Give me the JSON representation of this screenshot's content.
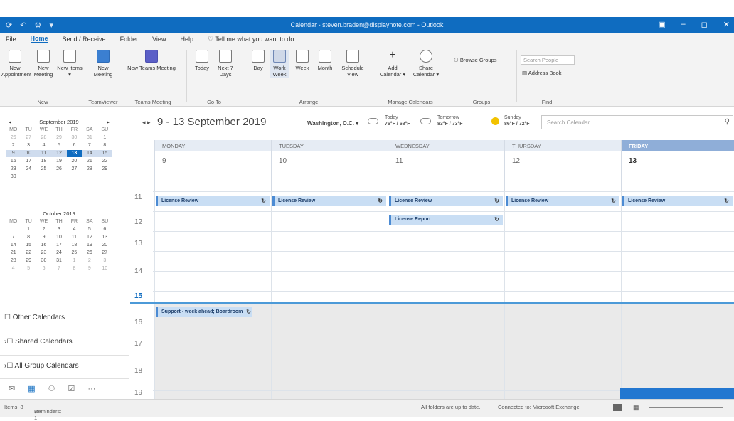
{
  "window": {
    "title": "Calendar - steven.braden@displaynote.com - Outlook",
    "qat": "⟳ ↶ ⚙ ▾"
  },
  "menu": [
    "File",
    "Home",
    "Send / Receive",
    "Folder",
    "View",
    "Help",
    "Tell me what you want to do"
  ],
  "ribbon": {
    "new_appointment": "New Appointment",
    "new_meeting": "New Meeting",
    "new_items": "New Items ▾",
    "new_meeting_tv": "New Meeting",
    "new_teams_meeting": "New Teams Meeting",
    "today": "Today",
    "next7": "Next 7 Days",
    "day": "Day",
    "work_week": "Work Week",
    "week": "Week",
    "month": "Month",
    "schedule_view": "Schedule View",
    "add_calendar": "Add Calendar ▾",
    "share_calendar": "Share Calendar ▾",
    "browse_groups": "Browse Groups",
    "search_people": "Search People",
    "address_book": "Address Book",
    "groups": {
      "new": "New",
      "teamviewer": "TeamViewer",
      "teams_meeting": "Teams Meeting",
      "go_to": "Go To",
      "arrange": "Arrange",
      "manage": "Manage Calendars",
      "groups": "Groups",
      "find": "Find"
    }
  },
  "mini_cal": [
    {
      "title": "September 2019",
      "days": [
        "MO",
        "TU",
        "WE",
        "TH",
        "FR",
        "SA",
        "SU"
      ],
      "rows": [
        [
          "26",
          "27",
          "28",
          "29",
          "30",
          "31",
          "1"
        ],
        [
          "2",
          "3",
          "4",
          "5",
          "6",
          "7",
          "8"
        ],
        [
          "9",
          "10",
          "11",
          "12",
          "13",
          "14",
          "15"
        ],
        [
          "16",
          "17",
          "18",
          "19",
          "20",
          "21",
          "22"
        ],
        [
          "23",
          "24",
          "25",
          "26",
          "27",
          "28",
          "29"
        ],
        [
          "30",
          "",
          "",
          "",
          "",
          "",
          ""
        ]
      ]
    },
    {
      "title": "October 2019",
      "days": [
        "MO",
        "TU",
        "WE",
        "TH",
        "FR",
        "SA",
        "SU"
      ],
      "rows": [
        [
          "",
          "1",
          "2",
          "3",
          "4",
          "5",
          "6"
        ],
        [
          "7",
          "8",
          "9",
          "10",
          "11",
          "12",
          "13"
        ],
        [
          "14",
          "15",
          "16",
          "17",
          "18",
          "19",
          "20"
        ],
        [
          "21",
          "22",
          "23",
          "24",
          "25",
          "26",
          "27"
        ],
        [
          "28",
          "29",
          "30",
          "31",
          "1",
          "2",
          "3"
        ],
        [
          "4",
          "5",
          "6",
          "7",
          "8",
          "9",
          "10"
        ]
      ]
    }
  ],
  "folders": [
    "Other Calendars",
    "Shared Calendars",
    "All Group Calendars"
  ],
  "calendar": {
    "range": "9 - 13 September 2019",
    "location": "Washington, D.C. ▾",
    "weather": [
      {
        "day": "Today",
        "temp": "76°F / 68°F"
      },
      {
        "day": "Tomorrow",
        "temp": "83°F / 73°F"
      },
      {
        "day": "Sunday",
        "temp": "86°F / 72°F"
      }
    ],
    "search_placeholder": "Search Calendar",
    "days": [
      {
        "name": "MONDAY",
        "num": "9"
      },
      {
        "name": "TUESDAY",
        "num": "10"
      },
      {
        "name": "WEDNESDAY",
        "num": "11"
      },
      {
        "name": "THURSDAY",
        "num": "12"
      },
      {
        "name": "FRIDAY",
        "num": "13"
      }
    ],
    "hours": [
      "11",
      "12",
      "13",
      "14",
      "15",
      "16",
      "17",
      "18",
      "19"
    ],
    "events": {
      "license_review": "License Review",
      "license_report": "License Report",
      "support": "Support - week ahead; Boardroom"
    }
  },
  "status": {
    "items": "Items: 8",
    "reminders": "Reminders: 1",
    "sync": "All folders are up to date.",
    "connection": "Connected to: Microsoft Exchange"
  },
  "colors": {
    "accent": "#0f6cc0",
    "event": "#c9def4"
  }
}
